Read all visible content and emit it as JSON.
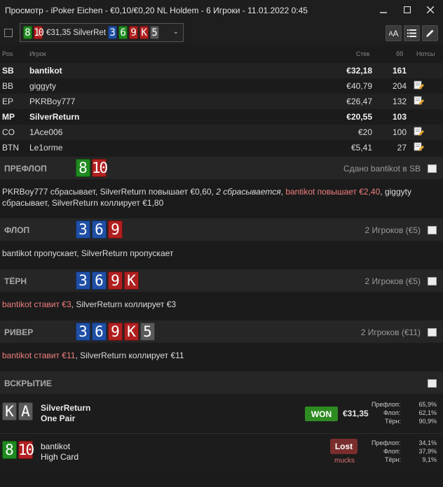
{
  "window": {
    "title": "Просмотр - iPoker Eichen - €0,10/€0,20 NL Holdem - 6 Игроки - 11.01.2022 0:45",
    "minimize_icon": "minimize-icon",
    "maximize_icon": "maximize-icon",
    "close_icon": "close-icon"
  },
  "toolbar": {
    "hand_select": {
      "hole_cards": [
        {
          "rank": "8",
          "color": "green"
        },
        {
          "rank": "10",
          "color": "red"
        }
      ],
      "text": "€31,35 SilverRet",
      "board": [
        {
          "rank": "3",
          "color": "blue"
        },
        {
          "rank": "6",
          "color": "green"
        },
        {
          "rank": "9",
          "color": "red"
        },
        {
          "rank": "K",
          "color": "red"
        },
        {
          "rank": "5",
          "color": "gray"
        }
      ]
    },
    "buttons": [
      {
        "name": "font-size-button",
        "label": "AA"
      },
      {
        "name": "list-view-button",
        "label": "≣"
      },
      {
        "name": "edit-button",
        "label": "✎"
      }
    ]
  },
  "table_header": {
    "pos": "Pos",
    "player": "Игрок",
    "stack": "Стек",
    "bb": "бб",
    "notes": "Нотсы"
  },
  "players": [
    {
      "pos": "SB",
      "name": "bantikot",
      "stack": "€32,18",
      "bb": "161",
      "highlight": true,
      "note": false
    },
    {
      "pos": "BB",
      "name": "giggyty",
      "stack": "€40,79",
      "bb": "204",
      "highlight": false,
      "note": true
    },
    {
      "pos": "EP",
      "name": "PKRBoy777",
      "stack": "€26,47",
      "bb": "132",
      "highlight": false,
      "note": true
    },
    {
      "pos": "MP",
      "name": "SilverReturn",
      "stack": "€20,55",
      "bb": "103",
      "highlight": true,
      "note": false
    },
    {
      "pos": "CO",
      "name": "1Ace006",
      "stack": "€20",
      "bb": "100",
      "highlight": false,
      "note": true
    },
    {
      "pos": "BTN",
      "name": "Le1orme",
      "stack": "€5,41",
      "bb": "27",
      "highlight": false,
      "note": true
    }
  ],
  "streets": {
    "preflop": {
      "name": "ПРЕФЛОП",
      "cards": [
        {
          "rank": "8",
          "color": "green"
        },
        {
          "rank": "10",
          "color": "red"
        }
      ],
      "info": "Сдано bantikot в SB",
      "actions": [
        {
          "text": "PKRBoy777 сбрасывает, SilverReturn повышает €0,60, ",
          "style": ""
        },
        {
          "text": "2 сбрасывается",
          "style": "ital"
        },
        {
          "text": ", ",
          "style": ""
        },
        {
          "text": "bantikot повышает €2,40",
          "style": "red"
        },
        {
          "text": ", giggyty сбрасывает, SilverReturn коллирует €1,80",
          "style": ""
        }
      ]
    },
    "flop": {
      "name": "ФЛОП",
      "cards": [
        {
          "rank": "3",
          "color": "blue"
        },
        {
          "rank": "6",
          "color": "blue"
        },
        {
          "rank": "9",
          "color": "red"
        }
      ],
      "info": "2 Игроков (€5)",
      "actions": [
        {
          "text": "bantikot пропускает, SilverReturn пропускает",
          "style": ""
        }
      ]
    },
    "turn": {
      "name": "ТЁРН",
      "cards": [
        {
          "rank": "3",
          "color": "blue"
        },
        {
          "rank": "6",
          "color": "blue"
        },
        {
          "rank": "9",
          "color": "red"
        },
        {
          "rank": "K",
          "color": "red"
        }
      ],
      "info": "2 Игроков (€5)",
      "actions": [
        {
          "text": "bantikot ставит €3",
          "style": "red"
        },
        {
          "text": ", SilverReturn коллирует €3",
          "style": ""
        }
      ]
    },
    "river": {
      "name": "РИВЕР",
      "cards": [
        {
          "rank": "3",
          "color": "blue"
        },
        {
          "rank": "6",
          "color": "blue"
        },
        {
          "rank": "9",
          "color": "red"
        },
        {
          "rank": "K",
          "color": "red"
        },
        {
          "rank": "5",
          "color": "gray"
        }
      ],
      "info": "2 Игроков (€11)",
      "actions": [
        {
          "text": "bantikot ставит €11",
          "style": "red"
        },
        {
          "text": ", SilverReturn коллирует €11",
          "style": ""
        }
      ]
    },
    "showdown": {
      "name": "ВСКРЫТИЕ"
    }
  },
  "showdown": [
    {
      "name": "SilverReturn",
      "hand": "One Pair",
      "cards": [
        {
          "rank": "K",
          "color": "gray"
        },
        {
          "rank": "A",
          "color": "gray"
        }
      ],
      "result": "WON",
      "amount": "€31,35",
      "equity": [
        {
          "label": "Префлоп:",
          "value": "65,9%"
        },
        {
          "label": "Флоп:",
          "value": "62,1%"
        },
        {
          "label": "Тёрн:",
          "value": "90,9%"
        }
      ]
    },
    {
      "name": "bantikot",
      "hand": "High Card",
      "cards": [
        {
          "rank": "8",
          "color": "green"
        },
        {
          "rank": "10",
          "color": "red"
        }
      ],
      "result": "Lost",
      "sub": "mucks",
      "equity": [
        {
          "label": "Префлоп:",
          "value": "34,1%"
        },
        {
          "label": "Флоп:",
          "value": "37,9%"
        },
        {
          "label": "Тёрн:",
          "value": "9,1%"
        }
      ]
    }
  ]
}
